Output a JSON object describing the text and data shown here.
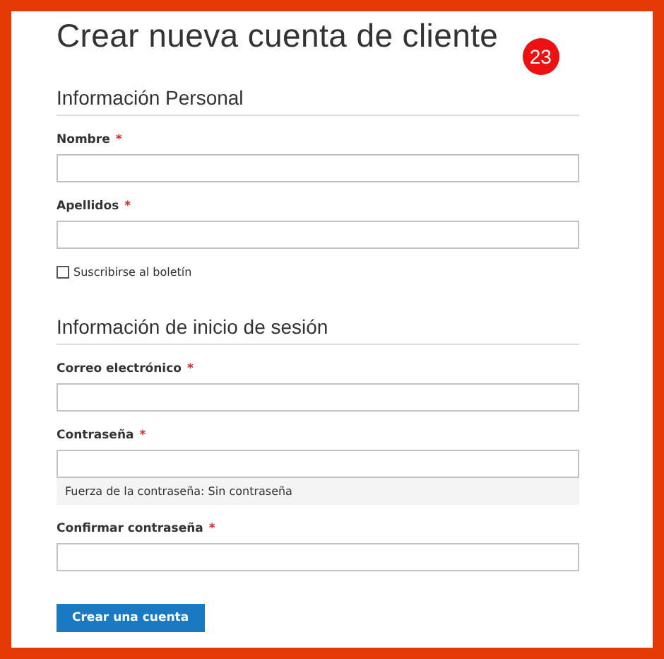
{
  "title": "Crear nueva cuenta de cliente",
  "badge": "23",
  "sections": [
    {
      "heading": "Información Personal",
      "fields": [
        {
          "kind": "text",
          "label": "Nombre",
          "required_mark": "*"
        },
        {
          "kind": "text",
          "label": "Apellidos",
          "required_mark": "*"
        },
        {
          "kind": "checkbox",
          "label": "Suscribirse al boletín",
          "checked": false
        }
      ]
    },
    {
      "heading": "Información de inicio de sesión",
      "fields": [
        {
          "kind": "text",
          "label": "Correo electrónico",
          "required_mark": "*"
        },
        {
          "kind": "password",
          "label": "Contraseña",
          "required_mark": "*",
          "strength": "Fuerza de la contraseña: Sin contraseña"
        },
        {
          "kind": "text",
          "label": "Confirmar contraseña",
          "required_mark": "*"
        }
      ]
    }
  ],
  "submit": "Crear una cuenta"
}
